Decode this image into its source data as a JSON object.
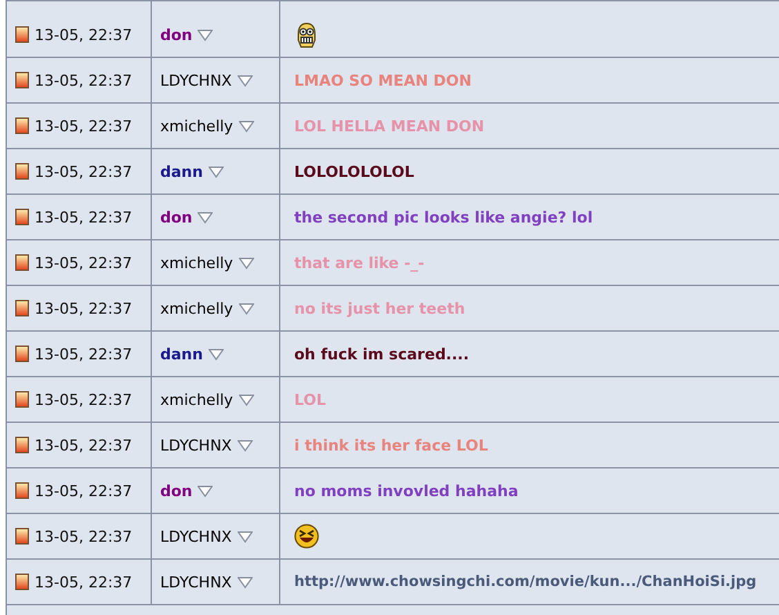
{
  "rows": [
    {
      "time": "13-05, 22:37",
      "user": {
        "name": "don",
        "color": "#800080",
        "bold": true
      },
      "message": {
        "kind": "grimace"
      }
    },
    {
      "time": "13-05, 22:37",
      "user": {
        "name": "LDYCHNX",
        "color": "#000000",
        "bold": false
      },
      "message": {
        "kind": "text",
        "text": "LMAO SO MEAN DON",
        "color": "#e8847d"
      }
    },
    {
      "time": "13-05, 22:37",
      "user": {
        "name": "xmichelly",
        "color": "#000000",
        "bold": false
      },
      "message": {
        "kind": "text",
        "text": "LOL HELLA MEAN DON",
        "color": "#e693aa"
      }
    },
    {
      "time": "13-05, 22:37",
      "user": {
        "name": "dann",
        "color": "#1a1a8c",
        "bold": true
      },
      "message": {
        "kind": "text",
        "text": "LOLOLOLOLOL",
        "color": "#5a0a1a"
      }
    },
    {
      "time": "13-05, 22:37",
      "user": {
        "name": "don",
        "color": "#800080",
        "bold": true
      },
      "message": {
        "kind": "text",
        "text": "the second pic looks like angie? lol",
        "color": "#8040c0"
      }
    },
    {
      "time": "13-05, 22:37",
      "user": {
        "name": "xmichelly",
        "color": "#000000",
        "bold": false
      },
      "message": {
        "kind": "text",
        "text": "that are like -_-",
        "color": "#e693aa"
      }
    },
    {
      "time": "13-05, 22:37",
      "user": {
        "name": "xmichelly",
        "color": "#000000",
        "bold": false
      },
      "message": {
        "kind": "text",
        "text": "no its just her teeth",
        "color": "#e693aa"
      }
    },
    {
      "time": "13-05, 22:37",
      "user": {
        "name": "dann",
        "color": "#1a1a8c",
        "bold": true
      },
      "message": {
        "kind": "text",
        "text": "oh fuck im scared....",
        "color": "#5a0a1a"
      }
    },
    {
      "time": "13-05, 22:37",
      "user": {
        "name": "xmichelly",
        "color": "#000000",
        "bold": false
      },
      "message": {
        "kind": "text",
        "text": "LOL",
        "color": "#e693aa"
      }
    },
    {
      "time": "13-05, 22:37",
      "user": {
        "name": "LDYCHNX",
        "color": "#000000",
        "bold": false
      },
      "message": {
        "kind": "text",
        "text": "i think its her face LOL",
        "color": "#e8847d"
      }
    },
    {
      "time": "13-05, 22:37",
      "user": {
        "name": "don",
        "color": "#800080",
        "bold": true
      },
      "message": {
        "kind": "text",
        "text": "no moms invovled hahaha",
        "color": "#8040c0"
      }
    },
    {
      "time": "13-05, 22:37",
      "user": {
        "name": "LDYCHNX",
        "color": "#000000",
        "bold": false
      },
      "message": {
        "kind": "laugh"
      }
    },
    {
      "time": "13-05, 22:37",
      "user": {
        "name": "LDYCHNX",
        "color": "#000000",
        "bold": false
      },
      "message": {
        "kind": "link",
        "text": "http://www.chowsingchi.com/movie/kun.../ChanHoiSi.jpg"
      }
    }
  ]
}
